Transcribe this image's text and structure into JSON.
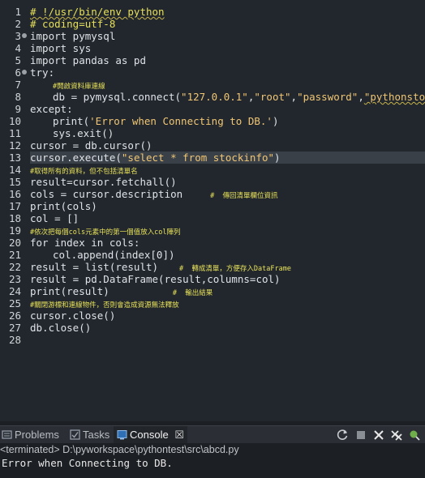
{
  "editor": {
    "line_numbers": [
      "1",
      "2",
      "3",
      "4",
      "5",
      "6",
      "7",
      "8",
      "9",
      "10",
      "11",
      "12",
      "13",
      "14",
      "15",
      "16",
      "17",
      "18",
      "19",
      "20",
      "21",
      "22",
      "23",
      "24",
      "25",
      "26",
      "27",
      "28"
    ],
    "l1": "# !/usr/bin/env python",
    "l2": "# coding=utf-8",
    "l3": "import pymysql",
    "l4": "import sys",
    "l5": "import pandas as pd",
    "l6": "try:",
    "l7": "#開啟資料庫連線",
    "l8a": "db = pymysql.connect(",
    "l8b": "\"127.0.0.1\"",
    "l8c": ",",
    "l8d": "\"root\"",
    "l8e": ",",
    "l8f": "\"password\"",
    "l8g": ",",
    "l8h": "\"pythonstock\"",
    "l8i": " )",
    "l9": "except:",
    "l10a": "print(",
    "l10b": "'Error when Connecting to DB.'",
    "l10c": ")",
    "l11": "sys.exit()",
    "l12": "cursor = db.cursor()",
    "l13a": "cursor.execute(",
    "l13b": "\"select * from stockinfo\"",
    "l13c": ")",
    "l14": "#取得所有的資料，但不包括清單名",
    "l15": "result=cursor.fetchall()",
    "l16a": "cols = cursor.description",
    "l16b": "#  傳回清單欄位資訊",
    "l17": "print(cols)",
    "l18": "col = []",
    "l19": "#依次把每個cols元素中的第一個值放入col陣列",
    "l20": "for index in cols:",
    "l21": "col.append(index[0])",
    "l22a": "result = list(result)",
    "l22b": "#  轉成清單，方便存入DataFrame",
    "l23": "result = pd.DataFrame(result,columns=col)",
    "l24a": "print(result)",
    "l24b": "#  輸出結果",
    "l25": "#關閉游標和連線物件，否則會造成資源無法釋放",
    "l26": "cursor.close()",
    "l27": "db.close()"
  },
  "console": {
    "tabs": [
      {
        "label": "Problems",
        "icon": "problems-icon"
      },
      {
        "label": "Tasks",
        "icon": "tasks-icon"
      },
      {
        "label": "Console",
        "icon": "console-icon"
      }
    ],
    "close_glyph": "☒",
    "terminated_path": "<terminated> D:\\pyworkspace\\pythontest\\src\\abcd.py",
    "output": "Error when Connecting to DB."
  }
}
